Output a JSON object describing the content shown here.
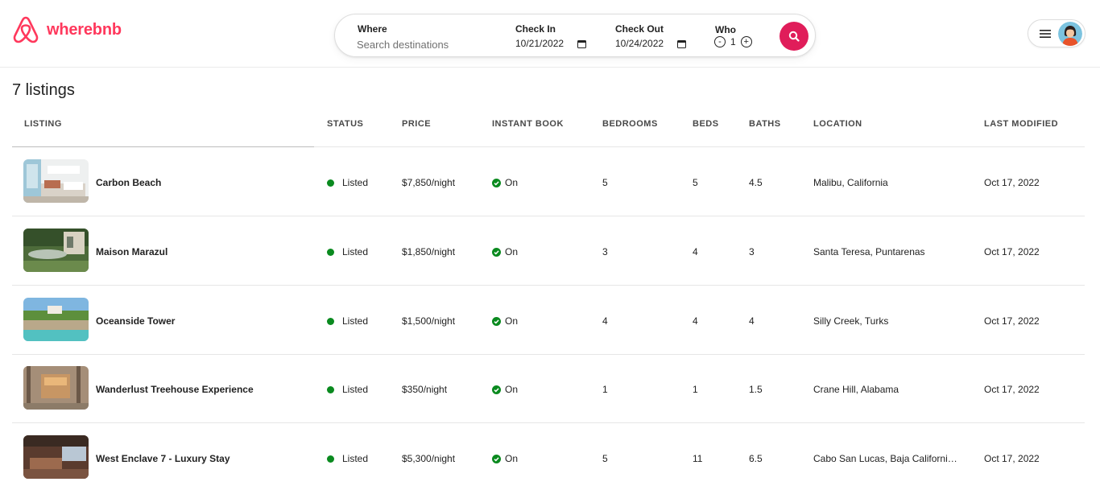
{
  "brand": {
    "name": "wherebnb",
    "accent": "#ff385c",
    "search_button_color": "#e01d5a"
  },
  "search": {
    "where_label": "Where",
    "where_placeholder": "Search destinations",
    "checkin_label": "Check In",
    "checkin_value": "10/21/2022",
    "checkout_label": "Check Out",
    "checkout_value": "10/24/2022",
    "who_label": "Who",
    "who_minus": "-",
    "who_count": "1",
    "who_plus": "+",
    "icons": {
      "calendar": "calendar-icon",
      "search": "search-icon",
      "minus": "minus-circle-icon",
      "plus": "plus-circle-icon"
    }
  },
  "user_menu": {
    "icons": {
      "menu": "hamburger-icon",
      "avatar": "avatar"
    }
  },
  "listings_count_title": "7 listings",
  "table": {
    "columns": [
      "LISTING",
      "STATUS",
      "PRICE",
      "INSTANT BOOK",
      "BEDROOMS",
      "BEDS",
      "BATHS",
      "LOCATION",
      "LAST MODIFIED"
    ],
    "status_color": "#0a8a1f",
    "rows": [
      {
        "name": "Carbon Beach",
        "status": "Listed",
        "price": "$7,850/night",
        "instant_book": "On",
        "bedrooms": "5",
        "beds": "5",
        "baths": "4.5",
        "location": "Malibu, California",
        "last_modified": "Oct 17, 2022"
      },
      {
        "name": "Maison Marazul",
        "status": "Listed",
        "price": "$1,850/night",
        "instant_book": "On",
        "bedrooms": "3",
        "beds": "4",
        "baths": "3",
        "location": "Santa Teresa, Puntarenas",
        "last_modified": "Oct 17, 2022"
      },
      {
        "name": "Oceanside Tower",
        "status": "Listed",
        "price": "$1,500/night",
        "instant_book": "On",
        "bedrooms": "4",
        "beds": "4",
        "baths": "4",
        "location": "Silly Creek, Turks",
        "last_modified": "Oct 17, 2022"
      },
      {
        "name": "Wanderlust Treehouse Experience",
        "status": "Listed",
        "price": "$350/night",
        "instant_book": "On",
        "bedrooms": "1",
        "beds": "1",
        "baths": "1.5",
        "location": "Crane Hill, Alabama",
        "last_modified": "Oct 17, 2022"
      },
      {
        "name": "West Enclave 7 - Luxury Stay",
        "status": "Listed",
        "price": "$5,300/night",
        "instant_book": "On",
        "bedrooms": "5",
        "beds": "11",
        "baths": "6.5",
        "location": "Cabo San Lucas, Baja California ...",
        "last_modified": "Oct 17, 2022"
      }
    ]
  }
}
